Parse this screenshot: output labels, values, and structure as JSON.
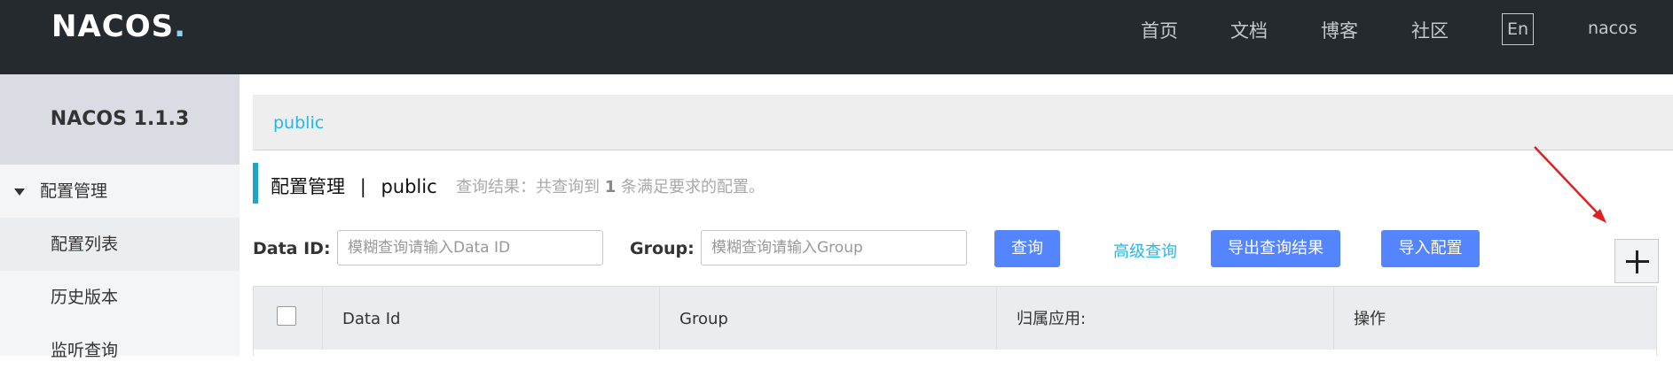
{
  "app": {
    "logo": {
      "main": "NACOS",
      "dot": "."
    },
    "nav": [
      {
        "label": "首页"
      },
      {
        "label": "文档"
      },
      {
        "label": "博客"
      },
      {
        "label": "社区"
      }
    ],
    "lang_button": "En",
    "user": "nacos"
  },
  "sidebar": {
    "title": "NACOS 1.1.3",
    "group": "配置管理",
    "items": [
      {
        "label": "配置列表"
      },
      {
        "label": "历史版本"
      },
      {
        "label": "监听查询"
      }
    ]
  },
  "namespace_bar": {
    "active": "public"
  },
  "header": {
    "title": "配置管理",
    "separator": "|",
    "namespace": "public",
    "result_prefix": "查询结果：共查询到",
    "result_count": "1",
    "result_suffix": "条满足要求的配置。"
  },
  "search": {
    "data_id_label": "Data ID:",
    "data_id_placeholder": "模糊查询请输入Data ID",
    "group_label": "Group:",
    "group_placeholder": "模糊查询请输入Group",
    "query_button": "查询",
    "advanced_link": "高级查询",
    "export_button": "导出查询结果",
    "import_button": "导入配置"
  },
  "table": {
    "columns": [
      "Data Id",
      "Group",
      "归属应用:",
      "操作"
    ]
  },
  "colors": {
    "topbar": "#252a2f",
    "primary": "#5584ff",
    "link": "#23b7e5",
    "accent_bar": "#1fa4cc",
    "annotation_arrow": "#e02020"
  },
  "icons": {
    "add": "plus-icon",
    "expand": "caret-down-icon"
  }
}
